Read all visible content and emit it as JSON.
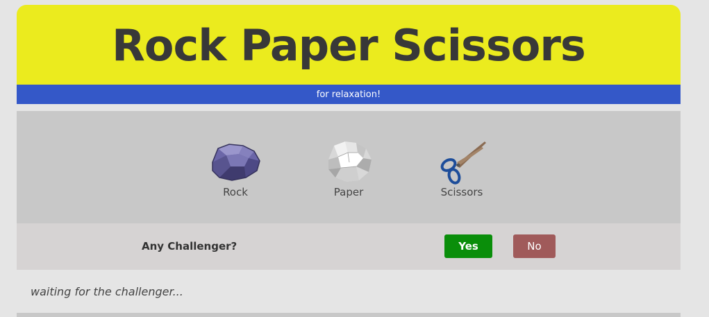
{
  "header": {
    "title": "Rock Paper Scissors",
    "subtitle": "for relaxation!"
  },
  "choices": [
    {
      "label": "Rock",
      "icon": "rock-icon"
    },
    {
      "label": "Paper",
      "icon": "crumpled-paper-icon"
    },
    {
      "label": "Scissors",
      "icon": "scissors-icon"
    }
  ],
  "challenge": {
    "prompt": "Any Challenger?",
    "yes_label": "Yes",
    "no_label": "No"
  },
  "status": {
    "text": "waiting for the challenger..."
  },
  "colors": {
    "header_bg": "#ebeb1e",
    "subtitle_bar": "#3458c8",
    "yes_button": "#0a8e0a",
    "no_button": "#a05a5a",
    "choices_bg": "#c8c8c8",
    "prompt_bg": "#d6d3d3"
  }
}
